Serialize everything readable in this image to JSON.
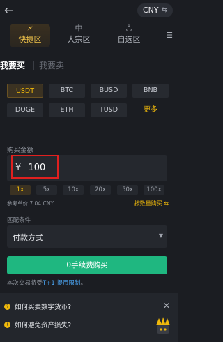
{
  "header": {
    "currency": "CNY"
  },
  "modes": [
    {
      "label": "快捷区",
      "active": true
    },
    {
      "label": "大宗区",
      "active": false
    },
    {
      "label": "自选区",
      "active": false
    }
  ],
  "side_tabs": {
    "buy": "我要买",
    "sell": "我要卖"
  },
  "coins": [
    "USDT",
    "BTC",
    "BUSD",
    "BNB",
    "DOGE",
    "ETH",
    "TUSD"
  ],
  "more_label": "更多",
  "amount": {
    "label": "购买金额",
    "currency_symbol": "¥",
    "value": "100"
  },
  "multipliers": [
    "1x",
    "5x",
    "10x",
    "20x",
    "50x",
    "100x"
  ],
  "ref_price": "参考单价 7.04 CNY",
  "by_quantity": "按数量购买",
  "match": {
    "label": "匹配条件",
    "payment_method": "付款方式"
  },
  "buy_button": "0手续费购买",
  "notice": {
    "prefix": "本次交易将受",
    "highlight": "T+1 提币限制",
    "suffix": "。"
  },
  "faq": [
    "如何买卖数字货币?",
    "如何避免资产损失?"
  ],
  "colors": {
    "accent": "#f0b90b",
    "buy": "#1fb780",
    "highlight_box": "#e0201f"
  }
}
